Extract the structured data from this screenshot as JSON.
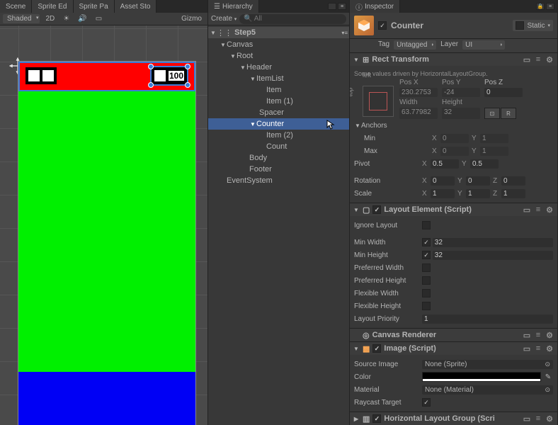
{
  "scene": {
    "tabs": [
      "Scene",
      "Sprite Ed",
      "Sprite Pa",
      "Asset Sto"
    ],
    "toolbar": {
      "shading": "Shaded",
      "mode2d": "2D",
      "gizmos": "Gizmo"
    },
    "counter_value": "100"
  },
  "hierarchy": {
    "title": "Hierarchy",
    "create": "Create",
    "search_placeholder": "All",
    "root": "Step5",
    "nodes": {
      "canvas": "Canvas",
      "root": "Root",
      "header": "Header",
      "itemlist": "ItemList",
      "item": "Item",
      "item1": "Item (1)",
      "spacer": "Spacer",
      "counter": "Counter",
      "item2": "Item (2)",
      "count": "Count",
      "body": "Body",
      "footer": "Footer",
      "eventsystem": "EventSystem"
    }
  },
  "inspector": {
    "title": "Inspector",
    "go_name": "Counter",
    "static_label": "Static",
    "tag_label": "Tag",
    "tag_value": "Untagged",
    "layer_label": "Layer",
    "layer_value": "UI",
    "rect": {
      "title": "Rect Transform",
      "driven": "Some values driven by HorizontalLayoutGroup.",
      "anchor_top": "top",
      "anchor_left": "left",
      "posx_l": "Pos X",
      "posx": "230.2753",
      "posy_l": "Pos Y",
      "posy": "-24",
      "posz_l": "Pos Z",
      "posz": "0",
      "width_l": "Width",
      "width": "63.77982",
      "height_l": "Height",
      "height": "32",
      "bp_r": "R",
      "anchors": "Anchors",
      "min": "Min",
      "minx": "0",
      "miny": "1",
      "max": "Max",
      "maxx": "0",
      "maxy": "1",
      "pivot": "Pivot",
      "pivx": "0.5",
      "pivy": "0.5",
      "rotation": "Rotation",
      "rotx": "0",
      "roty": "0",
      "rotz": "0",
      "scale": "Scale",
      "sx": "1",
      "sy": "1",
      "sz": "1"
    },
    "layout_element": {
      "title": "Layout Element (Script)",
      "ignore": "Ignore Layout",
      "minw": "Min Width",
      "minw_v": "32",
      "minh": "Min Height",
      "minh_v": "32",
      "prefw": "Preferred Width",
      "prefh": "Preferred Height",
      "flexw": "Flexible Width",
      "flexh": "Flexible Height",
      "prio": "Layout Priority",
      "prio_v": "1"
    },
    "canvas_renderer": {
      "title": "Canvas Renderer"
    },
    "image": {
      "title": "Image (Script)",
      "src": "Source Image",
      "src_v": "None (Sprite)",
      "color": "Color",
      "mat": "Material",
      "mat_v": "None (Material)",
      "raycast": "Raycast Target"
    },
    "hlg": {
      "title": "Horizontal Layout Group (Scri"
    }
  }
}
